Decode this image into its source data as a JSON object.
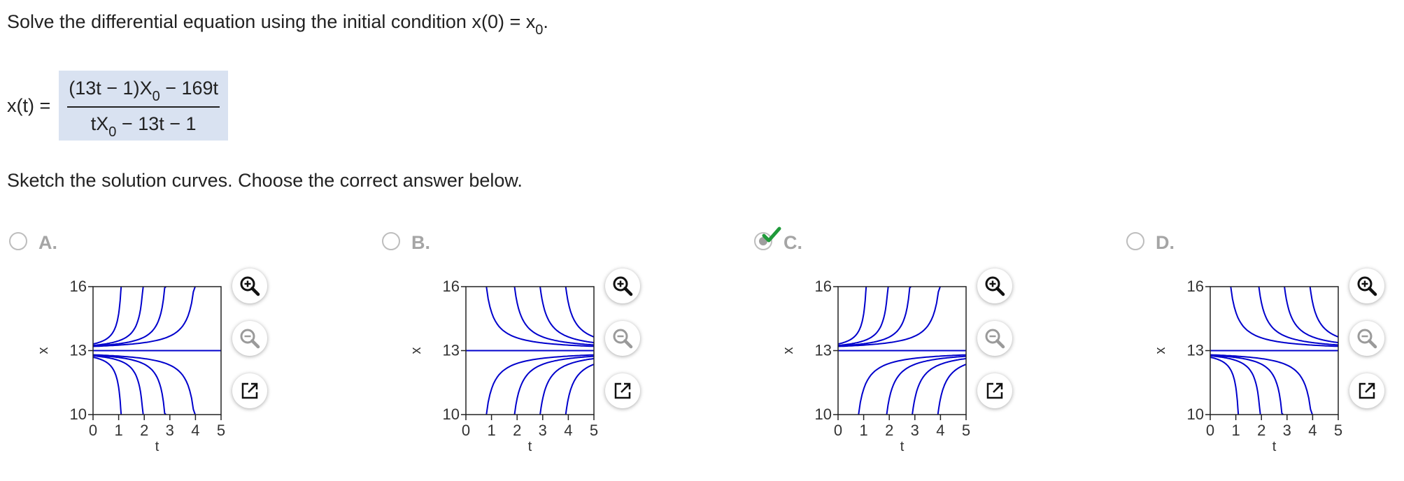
{
  "question": {
    "prompt_text": "Solve the differential equation using the initial condition x(0) = x",
    "prompt_sub": "0",
    "prompt_end": ".",
    "answer_lhs": "x(t) =",
    "numerator_a": "(13t − 1)X",
    "numerator_sub": "0",
    "numerator_b": " − 169t",
    "denominator_a": "tX",
    "denominator_sub": "0",
    "denominator_b": " − 13t − 1",
    "sketch_prompt": "Sketch the solution curves. Choose the correct answer below."
  },
  "choices": [
    {
      "label": "A.",
      "selected": false,
      "correct": false
    },
    {
      "label": "B.",
      "selected": false,
      "correct": false
    },
    {
      "label": "C.",
      "selected": true,
      "correct": true
    },
    {
      "label": "D.",
      "selected": false,
      "correct": false
    }
  ],
  "plot_axes": {
    "xlabel": "t",
    "ylabel": "x",
    "xticks": [
      "0",
      "1",
      "2",
      "3",
      "4",
      "5"
    ],
    "yticks": [
      "10",
      "13",
      "16"
    ],
    "xlim": [
      0,
      5
    ],
    "ylim": [
      10,
      16
    ],
    "line_color": "#0000cc"
  },
  "tools": {
    "zoom_in_icon": "zoom-in-icon",
    "zoom_out_icon": "zoom-out-icon",
    "popout_icon": "popout-icon"
  },
  "chart_data": [
    {
      "type": "line",
      "panel": "A",
      "description_upper": "curves above x=13 increase to +infinity",
      "lower": "curves below x=13 decrease to -infinity",
      "equilibrium": 13,
      "xlim": [
        0,
        5
      ],
      "ylim": [
        10,
        16
      ],
      "xlabel": "t",
      "ylabel": "x",
      "upper_blowup_t": [
        1.2,
        2.1,
        3.0,
        4.2
      ],
      "lower_blowup_t": [
        1.2,
        2.1,
        3.0,
        4.2
      ]
    },
    {
      "type": "line",
      "panel": "B",
      "upper": "curves above x=13 decrease toward 13",
      "lower": "curves below x=13 increase toward 13",
      "equilibrium": 13,
      "xlim": [
        0,
        5
      ],
      "ylim": [
        10,
        16
      ],
      "xlabel": "t",
      "ylabel": "x",
      "upper_vertical_t": [
        0.8,
        1.9,
        2.9,
        3.9
      ],
      "lower_vertical_t": [
        0.8,
        1.9,
        2.9,
        3.9
      ]
    },
    {
      "type": "line",
      "panel": "C",
      "upper": "curves above x=13 increase to +infinity",
      "lower": "curves below x=13 increase toward 13",
      "equilibrium": 13,
      "xlim": [
        0,
        5
      ],
      "ylim": [
        10,
        16
      ],
      "xlabel": "t",
      "ylabel": "x",
      "upper_blowup_t": [
        1.2,
        2.1,
        3.0,
        4.2
      ],
      "lower_vertical_t": [
        0.8,
        1.9,
        2.9,
        3.9
      ]
    },
    {
      "type": "line",
      "panel": "D",
      "upper": "curves above x=13 decrease toward 13",
      "lower": "curves below x=13 decrease to -infinity",
      "equilibrium": 13,
      "xlim": [
        0,
        5
      ],
      "ylim": [
        10,
        16
      ],
      "xlabel": "t",
      "ylabel": "x",
      "upper_vertical_t": [
        0.8,
        1.9,
        2.9,
        3.9
      ],
      "lower_blowup_t": [
        1.2,
        2.1,
        3.0,
        4.2
      ]
    }
  ]
}
